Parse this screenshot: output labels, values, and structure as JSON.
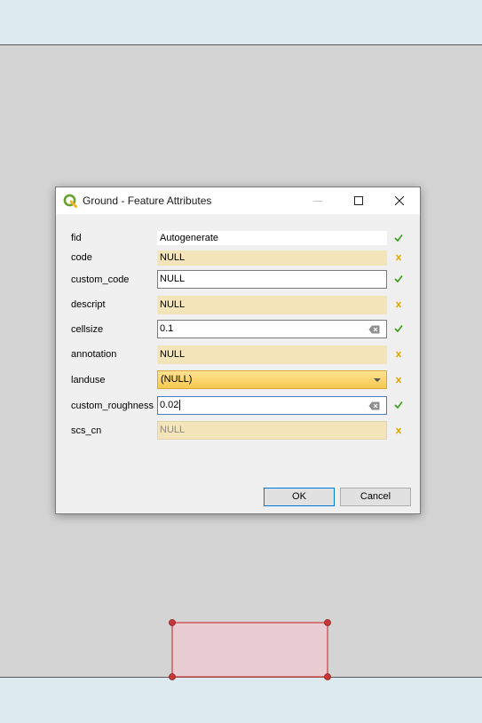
{
  "dialog": {
    "title": "Ground - Feature Attributes",
    "fields": [
      {
        "label": "fid",
        "value": "Autogenerate",
        "style": "plain-readonly",
        "status": "ok"
      },
      {
        "label": "code",
        "value": "NULL",
        "style": "null-readonly",
        "status": "unchanged"
      },
      {
        "label": "custom_code",
        "value": "NULL",
        "style": "editable",
        "status": "ok"
      },
      {
        "label": "descript",
        "value": "NULL",
        "style": "null-readonly",
        "status": "unchanged"
      },
      {
        "label": "cellsize",
        "value": "0.1",
        "style": "editable",
        "status": "ok"
      },
      {
        "label": "annotation",
        "value": "NULL",
        "style": "null-readonly",
        "status": "unchanged"
      },
      {
        "label": "landuse",
        "value": "(NULL)",
        "style": "combo",
        "status": "unchanged"
      },
      {
        "label": "custom_roughness",
        "value": "0.02",
        "style": "editable",
        "status": "ok"
      },
      {
        "label": "scs_cn",
        "value": "NULL",
        "style": "disabled",
        "status": "unchanged"
      }
    ],
    "ok_label": "OK",
    "cancel_label": "Cancel"
  },
  "colors": {
    "ok_check": "#3a9a1f",
    "unchanged_mark": "#e0a800",
    "null_field": "#f4e4b9",
    "combo_top": "#ffe292",
    "combo_bottom": "#f7c94f",
    "canvas": "#d4d4d4",
    "band": "#ddebf1",
    "feature_fill": "#e8cdd3",
    "feature_stroke": "#d23b3b"
  },
  "icons": {
    "app": "qgis-logo-icon",
    "minimize": "minimize-icon",
    "maximize": "maximize-icon",
    "close": "close-icon",
    "clear": "clear-text-icon",
    "ok_status": "checkmark-icon",
    "unchanged_status": "cross-mark-icon",
    "combo": "chevron-down-icon"
  }
}
